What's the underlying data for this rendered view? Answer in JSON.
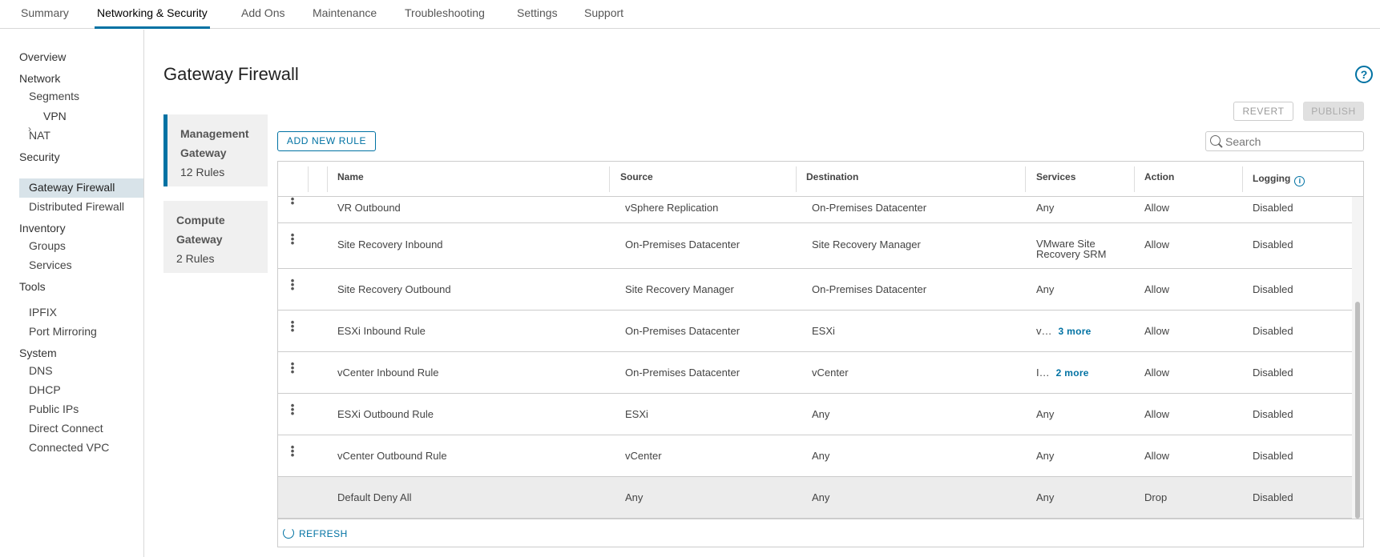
{
  "top_tabs": [
    "Summary",
    "Networking & Security",
    "Add Ons",
    "Maintenance",
    "Troubleshooting",
    "Settings",
    "Support"
  ],
  "active_tab": "Networking & Security",
  "sidebar": {
    "overview": "Overview",
    "network": "Network",
    "segments": "Segments",
    "vpn": "VPN",
    "nat": "NAT",
    "security": "Security",
    "gateway_firewall": "Gateway Firewall",
    "distributed_firewall": "Distributed Firewall",
    "inventory": "Inventory",
    "groups": "Groups",
    "services": "Services",
    "tools": "Tools",
    "ipfix": "IPFIX",
    "port_mirroring": "Port Mirroring",
    "system": "System",
    "dns": "DNS",
    "dhcp": "DHCP",
    "public_ips": "Public IPs",
    "direct_connect": "Direct Connect",
    "connected_vpc": "Connected VPC",
    "selected": "Gateway Firewall"
  },
  "page": {
    "title": "Gateway Firewall",
    "help_icon": "help-circle-icon"
  },
  "gateways": [
    {
      "line1": "Management",
      "line2": "Gateway",
      "rules": "12 Rules",
      "selected": true
    },
    {
      "line1": "Compute",
      "line2": "Gateway",
      "rules": "2 Rules",
      "selected": false
    }
  ],
  "toolbar": {
    "add_rule": "ADD NEW RULE",
    "revert": "REVERT",
    "publish": "PUBLISH",
    "search_placeholder": "Search"
  },
  "table": {
    "headers": {
      "name": "Name",
      "source": "Source",
      "destination": "Destination",
      "services": "Services",
      "action": "Action",
      "logging": "Logging"
    },
    "rows": [
      {
        "name": "VR Outbound",
        "source": "vSphere Replication",
        "destination": "On-Premises Datacenter",
        "services": "Any",
        "action": "Allow",
        "logging": "Disabled"
      },
      {
        "name": "Site Recovery Inbound",
        "source": "On-Premises Datacenter",
        "destination": "Site Recovery Manager",
        "services_line1": "VMware Site",
        "services_line2": "Recovery SRM",
        "action": "Allow",
        "logging": "Disabled"
      },
      {
        "name": "Site Recovery Outbound",
        "source": "Site Recovery Manager",
        "destination": "On-Premises Datacenter",
        "services": "Any",
        "action": "Allow",
        "logging": "Disabled"
      },
      {
        "name": "ESXi Inbound Rule",
        "source": "On-Premises Datacenter",
        "destination": "ESXi",
        "services": "v…",
        "more": "3 more",
        "action": "Allow",
        "logging": "Disabled"
      },
      {
        "name": "vCenter Inbound Rule",
        "source": "On-Premises Datacenter",
        "destination": "vCenter",
        "services": "I…",
        "more": "2 more",
        "action": "Allow",
        "logging": "Disabled"
      },
      {
        "name": "ESXi Outbound Rule",
        "source": "ESXi",
        "destination": "Any",
        "services": "Any",
        "action": "Allow",
        "logging": "Disabled"
      },
      {
        "name": "vCenter Outbound Rule",
        "source": "vCenter",
        "destination": "Any",
        "services": "Any",
        "action": "Allow",
        "logging": "Disabled"
      },
      {
        "name": "Default Deny All",
        "source": "Any",
        "destination": "Any",
        "services": "Any",
        "action": "Drop",
        "logging": "Disabled"
      }
    ],
    "refresh": "REFRESH"
  },
  "colors": {
    "accent": "#0072a3",
    "selected_bg": "#d8e3e9",
    "default_row_bg": "#ececec"
  }
}
